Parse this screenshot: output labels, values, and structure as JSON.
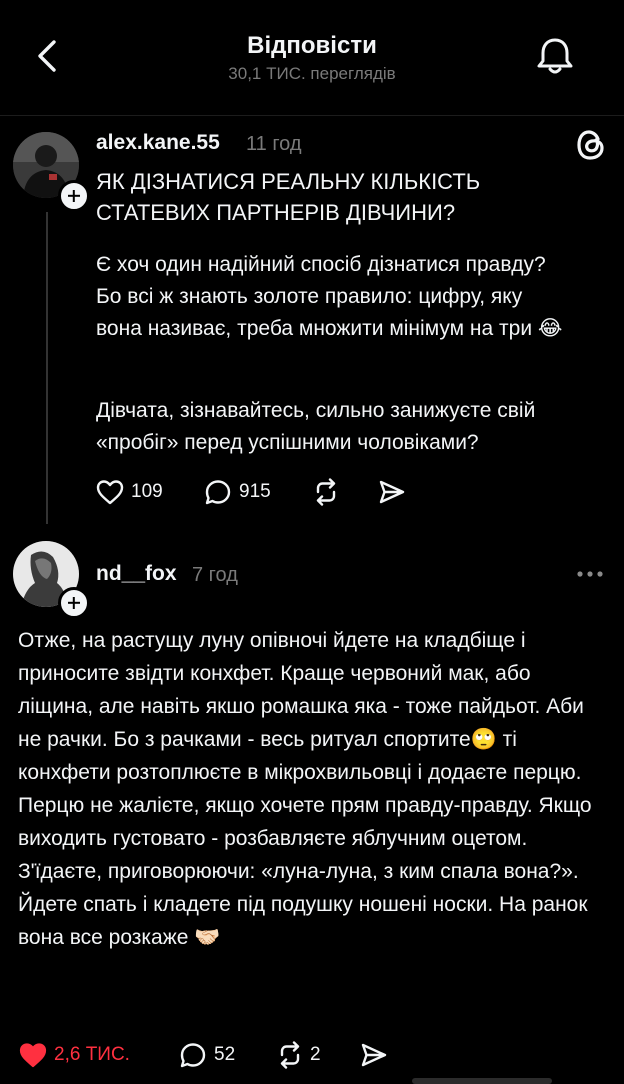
{
  "header": {
    "title": "Відповісти",
    "subtitle": "30,1 ТИС. переглядів"
  },
  "post": {
    "username": "alex.kane.55",
    "time": "11 год",
    "title": "ЯК ДІЗНАТИСЯ РЕАЛЬНУ КІЛЬКІСТЬ СТАТЕВИХ ПАРТНЕРІВ ДІВЧИНИ?",
    "paragraph1": "Є хоч один надійний спосіб дізнатися правду? Бо всі ж знають золоте правило: цифру, яку вона називає, треба множити мінімум на три 😂",
    "paragraph2": "Дівчата, зізнавайтесь, сильно занижуєте свій «пробіг» перед успішними чоловіками?",
    "likes": "109",
    "comments": "915"
  },
  "reply": {
    "username": "nd__fox",
    "time": "7 год",
    "text": "Отже, на растущу луну опівночі йдете на кладбіще і приносите звідти конхфет. Краще червоний мак, або ліщина, але навіть якшо ромашка яка - тоже пайдьот. Аби не рачки. Бо з рачками - весь ритуал спортите🙄 ті конхфети розтоплюєте в мікрохвильовці і додаєте перцю. Перцю не жалієте, якщо хочете прям правду-правду. Якщо виходить густовато - розбавляєте яблучним оцетом. З'їдаєте, приговорюючи: «луна-луна, з ким спала вона?». Йдете спать і кладете під подушку ношені носки. На ранок вона все розкаже 🤝🏻",
    "likes": "2,6 ТИС.",
    "comments": "52",
    "reposts": "2"
  },
  "colors": {
    "background": "#000000",
    "text": "#f3f5f7",
    "muted": "#7a7a7a",
    "liked": "#ff3040"
  },
  "icons": [
    "back-chevron-icon",
    "bell-icon",
    "threads-logo-icon",
    "heart-icon",
    "comment-icon",
    "repost-icon",
    "share-icon",
    "more-dots-icon"
  ]
}
